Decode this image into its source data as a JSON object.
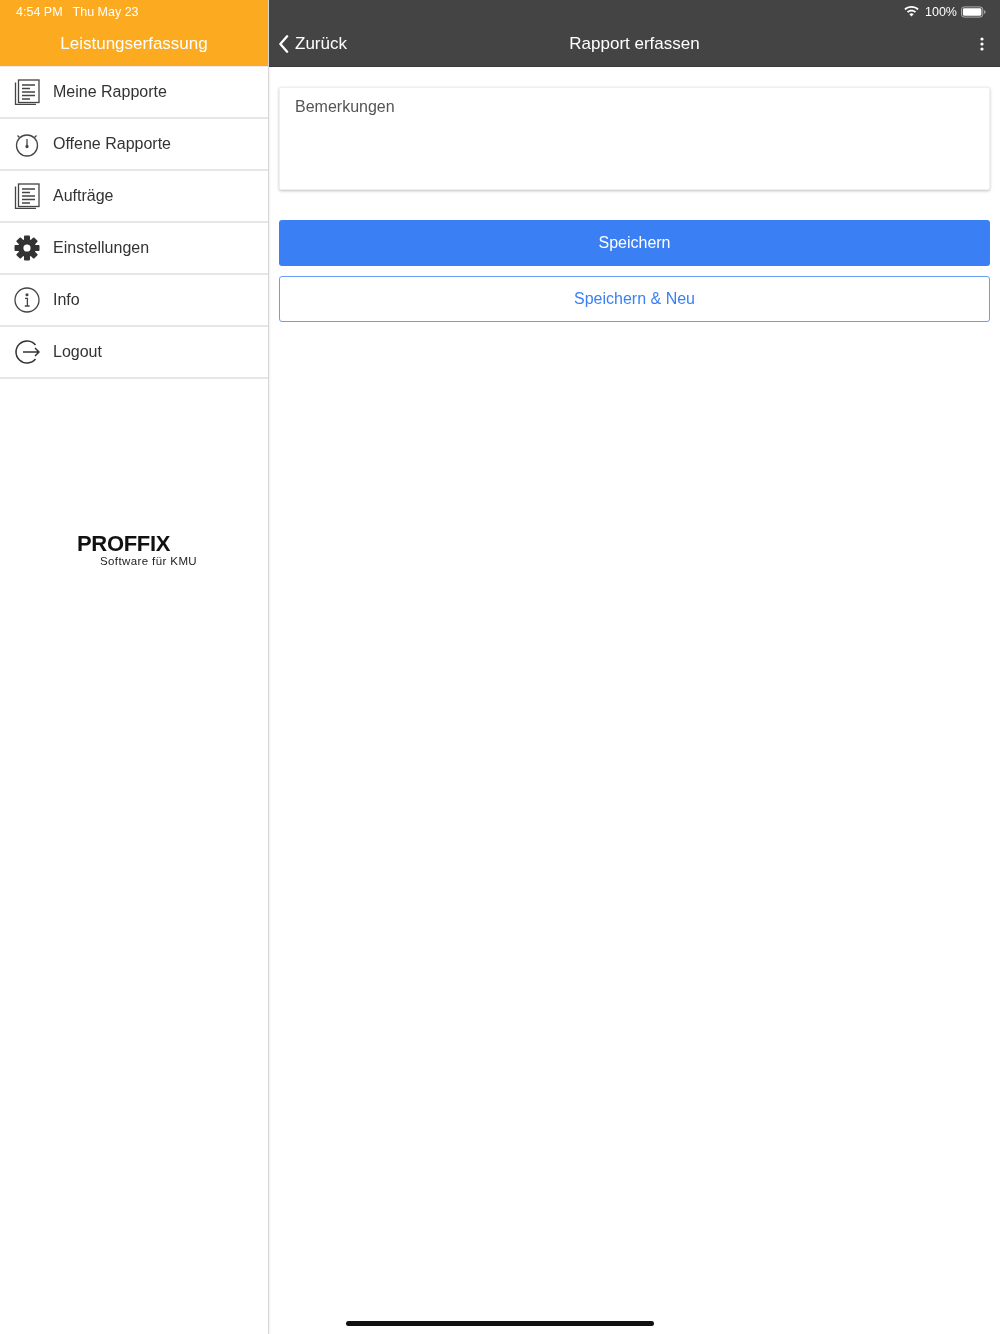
{
  "status_bar": {
    "time": "4:54 PM",
    "date": "Thu May 23",
    "battery": "100%"
  },
  "sidebar": {
    "title": "Leistungserfassung",
    "items": [
      {
        "label": "Meine Rapporte",
        "kind": "list"
      },
      {
        "label": "Offene Rapporte",
        "kind": "timer"
      },
      {
        "label": "Aufträge",
        "kind": "list"
      },
      {
        "label": "Einstellungen",
        "kind": "settings"
      },
      {
        "label": "Info",
        "kind": "info"
      },
      {
        "label": "Logout",
        "kind": "logout"
      }
    ],
    "logo": {
      "name": "PROFFIX",
      "tagline": "Software für KMU"
    }
  },
  "nav_bar": {
    "back": "Zurück",
    "title": "Rapport erfassen"
  },
  "form": {
    "remarks": {
      "placeholder": "Bemerkungen"
    }
  },
  "buttons": [
    {
      "label": "Speichern",
      "kind": "primary"
    },
    {
      "label": "Speichern & Neu",
      "kind": "outline"
    }
  ]
}
